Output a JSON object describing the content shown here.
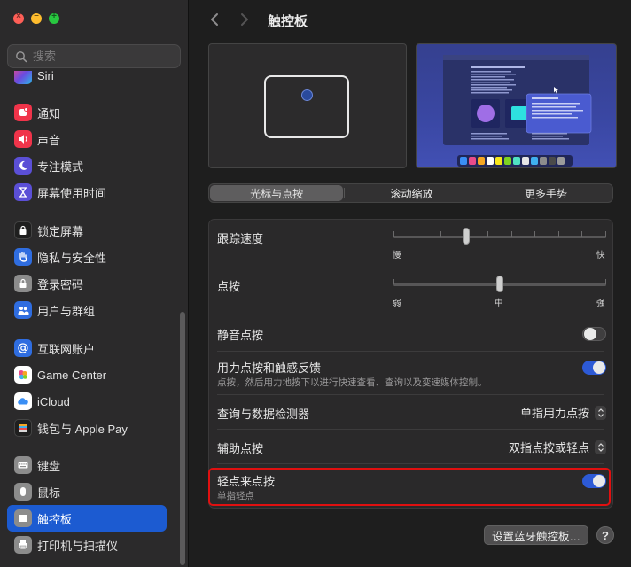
{
  "colors": {
    "accent": "#1c5bd1",
    "toggle_on": "#2d5ad6",
    "highlight": "#e01010"
  },
  "search": {
    "placeholder": "搜索"
  },
  "sidebar": {
    "items": [
      {
        "label": "Siri",
        "icon": "siri-icon",
        "color": "#b05ad9"
      },
      {
        "label": "通知",
        "icon": "bell-icon",
        "color": "#f0344a"
      },
      {
        "label": "声音",
        "icon": "speaker-icon",
        "color": "#f0344a"
      },
      {
        "label": "专注模式",
        "icon": "moon-icon",
        "color": "#5b4fd6"
      },
      {
        "label": "屏幕使用时间",
        "icon": "hourglass-icon",
        "color": "#5b4fd6"
      },
      {
        "label": "锁定屏幕",
        "icon": "lock-screen-icon",
        "color": "#1f1f1f"
      },
      {
        "label": "隐私与安全性",
        "icon": "hand-icon",
        "color": "#2f6de0"
      },
      {
        "label": "登录密码",
        "icon": "lock-icon",
        "color": "#8c8c8c"
      },
      {
        "label": "用户与群组",
        "icon": "users-icon",
        "color": "#2f6de0"
      },
      {
        "label": "互联网账户",
        "icon": "at-icon",
        "color": "#2f6de0"
      },
      {
        "label": "Game Center",
        "icon": "game-center-icon",
        "color": "#ffffff"
      },
      {
        "label": "iCloud",
        "icon": "cloud-icon",
        "color": "#ffffff"
      },
      {
        "label": "钱包与 Apple Pay",
        "icon": "wallet-icon",
        "color": "#1f1f1f"
      },
      {
        "label": "键盘",
        "icon": "keyboard-icon",
        "color": "#8c8c8c"
      },
      {
        "label": "鼠标",
        "icon": "mouse-icon",
        "color": "#8c8c8c"
      },
      {
        "label": "触控板",
        "icon": "trackpad-icon",
        "color": "#8c8c8c"
      },
      {
        "label": "打印机与扫描仪",
        "icon": "printer-icon",
        "color": "#8c8c8c"
      }
    ]
  },
  "header": {
    "title": "触控板"
  },
  "tabs": [
    {
      "label": "光标与点按",
      "selected": true
    },
    {
      "label": "滚动缩放",
      "selected": false
    },
    {
      "label": "更多手势",
      "selected": false
    }
  ],
  "settings": {
    "tracking": {
      "label": "跟踪速度",
      "min_label": "慢",
      "max_label": "快",
      "value": 0.34
    },
    "click": {
      "label": "点按",
      "labels": [
        "弱",
        "中",
        "强"
      ],
      "value": 0.5
    },
    "silent_click": {
      "label": "静音点按",
      "on": false
    },
    "force_click": {
      "label": "用力点按和触感反馈",
      "description": "点按，然后用力地按下以进行快速查看、查询以及变速媒体控制。",
      "on": true
    },
    "lookup": {
      "label": "查询与数据检测器",
      "value": "单指用力点按"
    },
    "secondary_click": {
      "label": "辅助点按",
      "value": "双指点按或轻点"
    },
    "tap_to_click": {
      "label": "轻点来点按",
      "description": "单指轻点",
      "on": true
    }
  },
  "footer": {
    "bluetooth_button": "设置蓝牙触控板…",
    "help": "?"
  }
}
